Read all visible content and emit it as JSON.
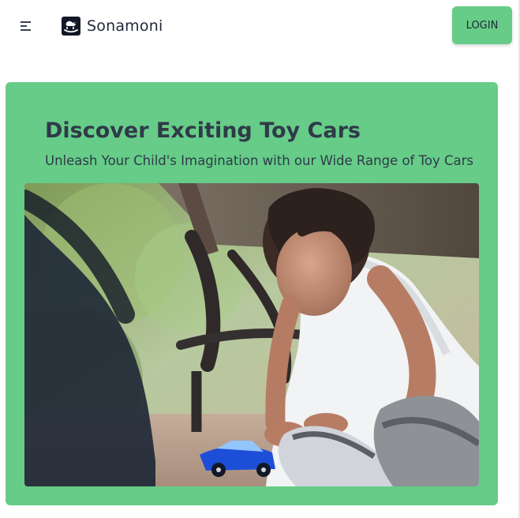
{
  "app": {
    "brand_name": "Sonamoni",
    "logo_icon": "rocking-horse-icon",
    "menu_icon": "menu-icon"
  },
  "header": {
    "login_label": "LOGIN",
    "login_color": "#66cc88"
  },
  "hero": {
    "title": "Discover Exciting Toy Cars",
    "subtitle": "Unleash Your Child's Imagination with our Wide Range of Toy Cars",
    "background_color": "#66cc88",
    "image_icon": "child-playing-toy-car-photo"
  }
}
